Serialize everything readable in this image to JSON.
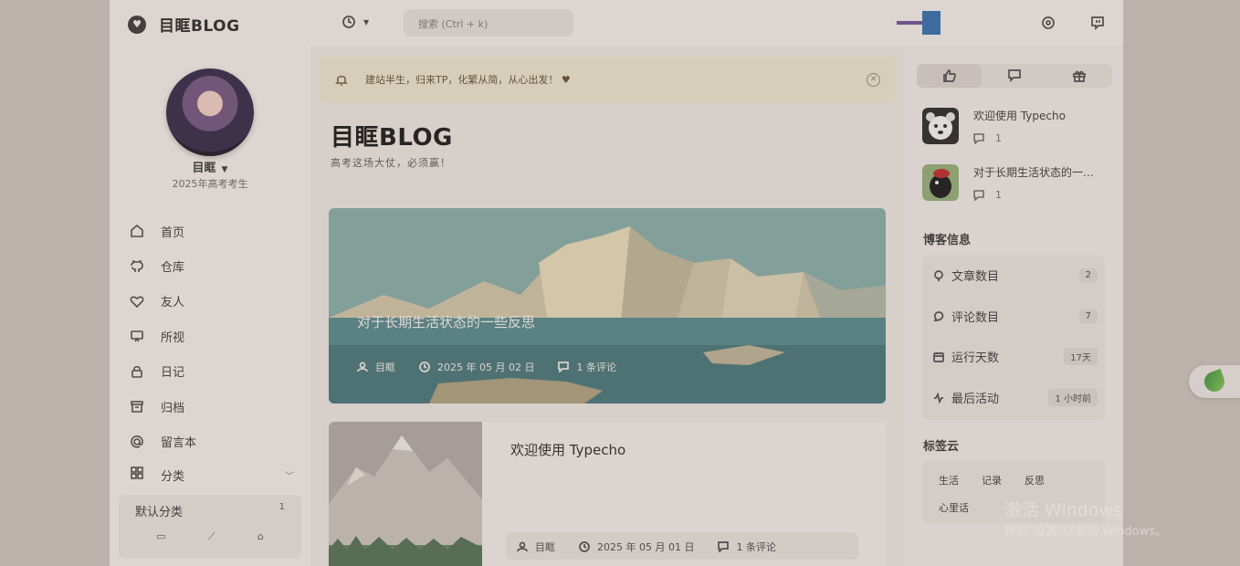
{
  "sidebar": {
    "brand_name": "目眶BLOG",
    "username": "目眶",
    "user_subtitle": "2025年高考考生",
    "nav": [
      {
        "label": "首页",
        "icon": "home-icon"
      },
      {
        "label": "仓库",
        "icon": "github-icon"
      },
      {
        "label": "友人",
        "icon": "heart-icon"
      },
      {
        "label": "所视",
        "icon": "monitor-icon"
      },
      {
        "label": "日记",
        "icon": "lock-icon"
      },
      {
        "label": "归档",
        "icon": "archive-icon"
      },
      {
        "label": "留言本",
        "icon": "at-icon"
      }
    ],
    "categories_label": "分类",
    "category": {
      "name": "默认分类",
      "count": "1"
    }
  },
  "header": {
    "search_placeholder": "搜索 (Ctrl + k)"
  },
  "notice": {
    "text": "建站半生，归来TP，化繁从简，从心出发！ ♥"
  },
  "main": {
    "title": "目眶BLOG",
    "subtitle": "高考这场大仗，必须赢！",
    "posts": [
      {
        "title": "对于长期生活状态的一些反思",
        "author": "目眶",
        "date": "2025 年 05 月 02 日",
        "comments": "1 条评论"
      },
      {
        "title": "欢迎使用 Typecho",
        "author": "目眶",
        "date": "2025 年 05 月 01 日",
        "comments": "1 条评论"
      }
    ]
  },
  "right": {
    "recent": [
      {
        "title": "欢迎使用 Typecho",
        "comments": "1"
      },
      {
        "title": "对于长期生活状态的一些反思",
        "comments": "1"
      }
    ],
    "info_title": "博客信息",
    "info": [
      {
        "label": "文章数目",
        "value": "2",
        "icon": "bulb-icon"
      },
      {
        "label": "评论数目",
        "value": "7",
        "icon": "comment-icon"
      },
      {
        "label": "运行天数",
        "value": "17天",
        "icon": "calendar-icon"
      },
      {
        "label": "最后活动",
        "value": "1 小时前",
        "icon": "activity-icon"
      }
    ],
    "tags_title": "标签云",
    "tags": [
      "生活",
      "记录",
      "反思",
      "心里话"
    ]
  },
  "watermark": {
    "line1": "激活 Windows",
    "line2": "转到\"设置\"以激活 Windows。"
  },
  "colors": {
    "flag_pole": "#6a4a8a",
    "flag_box": "#2a6aa8",
    "leaf": "#3f9a3a"
  }
}
